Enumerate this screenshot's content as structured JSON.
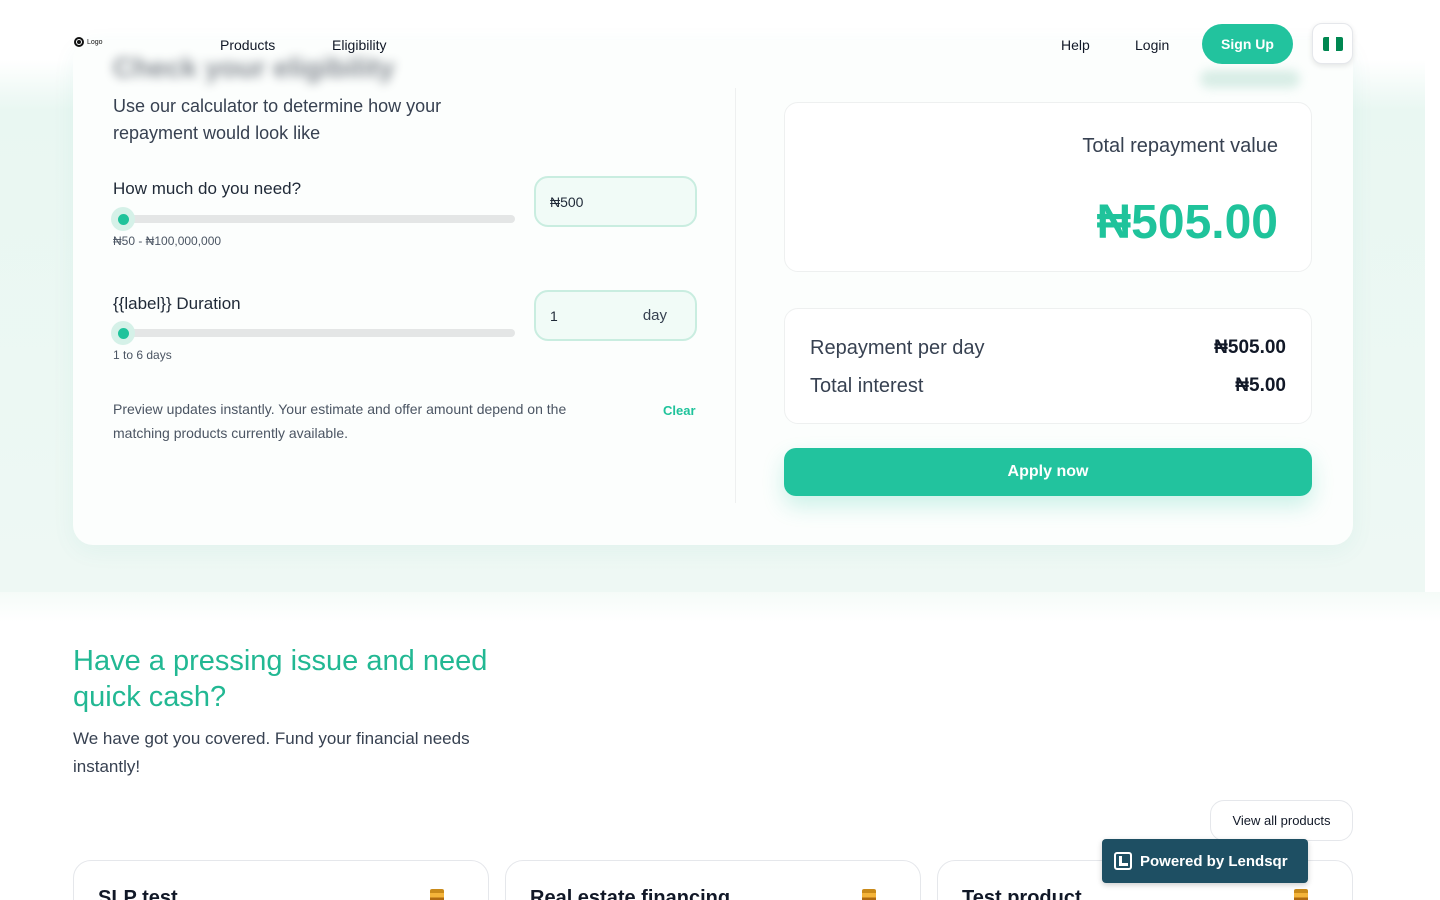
{
  "header": {
    "logo_text": "Logo",
    "nav": [
      "Products",
      "Eligibility"
    ],
    "help": "Help",
    "login": "Login",
    "signup": "Sign Up",
    "flag_colors": [
      "#008751",
      "#ffffff",
      "#008751"
    ]
  },
  "calculator": {
    "title": "Check your eligibility",
    "intro": "Use our calculator to determine how your repayment would look like",
    "amount": {
      "label": "How much do you need?",
      "range": "₦50 - ₦100,000,000",
      "value": "₦500",
      "slider_fraction": 0.0
    },
    "duration": {
      "label": "{{label}} Duration",
      "range": "1 to 6 days",
      "value": "1",
      "unit": "day",
      "slider_fraction": 0.0
    },
    "note": "Preview updates instantly. Your estimate and offer amount depend on the matching products currently available.",
    "clear": "Clear"
  },
  "summary": {
    "total_label": "Total repayment value",
    "total_value": "₦505.00",
    "rows": [
      {
        "label": "Repayment per day",
        "value": "₦505.00"
      },
      {
        "label": "Total interest",
        "value": "₦5.00"
      }
    ],
    "apply": "Apply now"
  },
  "promo": {
    "title": "Have a pressing issue and need quick cash?",
    "subtitle": "We have got you covered. Fund your financial needs instantly!",
    "view_all": "View all products"
  },
  "products": [
    {
      "name": "SLP test"
    },
    {
      "name": "Real estate financing"
    },
    {
      "name": "Test product"
    }
  ],
  "powered_by": "Powered by Lendsqr",
  "colors": {
    "accent": "#22c39e",
    "accent_dark": "#1e4f63"
  }
}
